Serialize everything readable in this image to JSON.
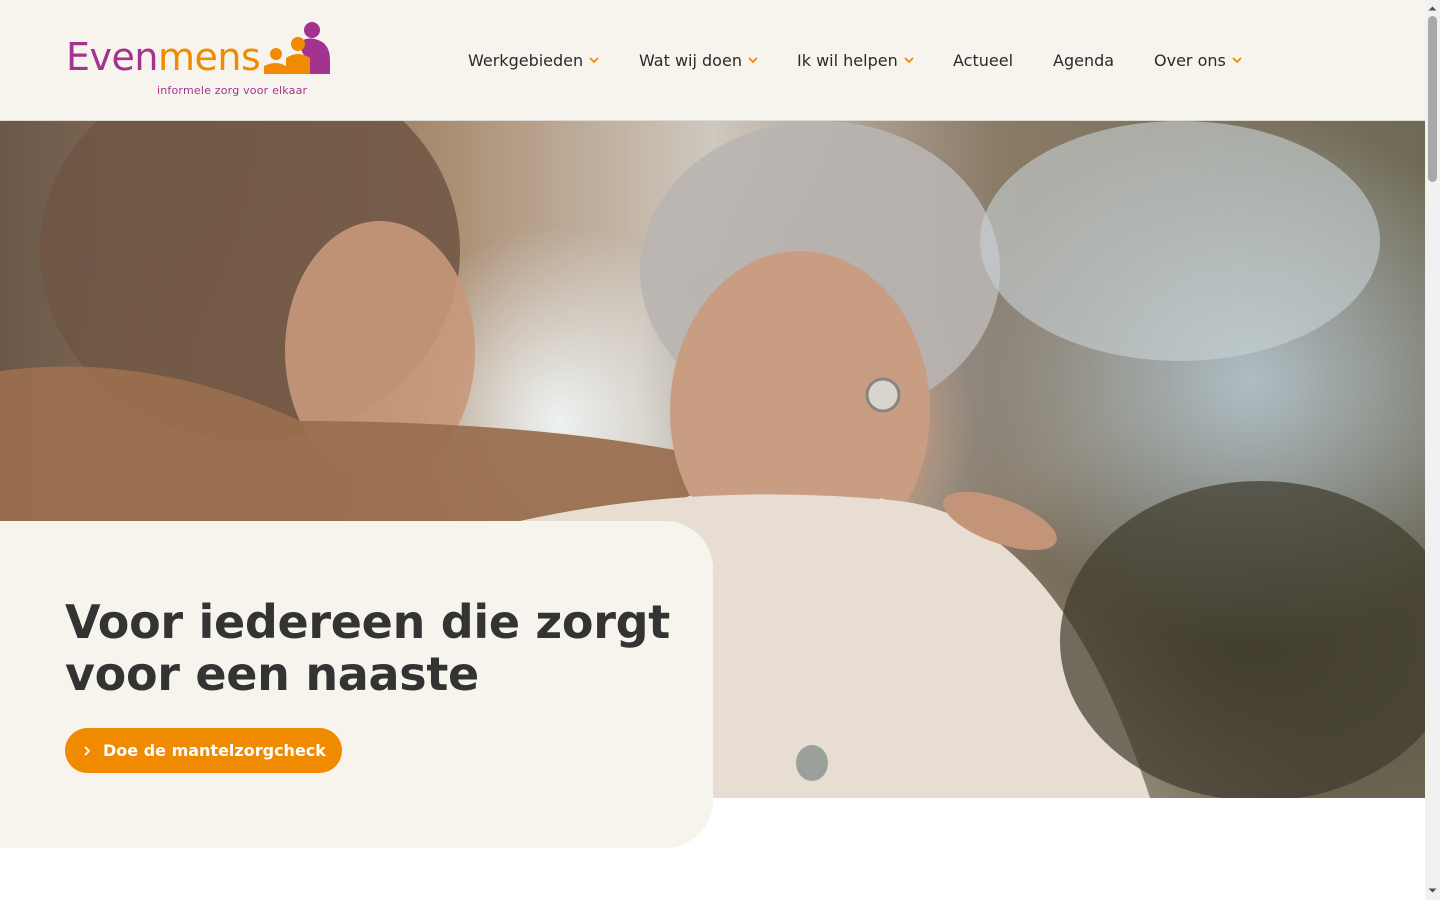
{
  "header": {
    "logo": {
      "word_part1": "Even",
      "word_part2": "mens",
      "tagline": "informele zorg voor elkaar",
      "colors": {
        "purple": "#a4338f",
        "orange": "#f08a00"
      }
    },
    "nav": [
      {
        "label": "Werkgebieden",
        "has_dropdown": true,
        "icon": "chevron-down-icon"
      },
      {
        "label": "Wat wij doen",
        "has_dropdown": true,
        "icon": "chevron-down-icon"
      },
      {
        "label": "Ik wil helpen",
        "has_dropdown": true,
        "icon": "chevron-down-icon"
      },
      {
        "label": "Actueel",
        "has_dropdown": false
      },
      {
        "label": "Agenda",
        "has_dropdown": false
      },
      {
        "label": "Over ons",
        "has_dropdown": true,
        "icon": "chevron-down-icon"
      }
    ]
  },
  "hero": {
    "image_alt": "photo",
    "title": "Voor iedereen die zorgt voor een naaste",
    "cta": {
      "label": "Doe de mantelzorgcheck",
      "icon": "chevron-right-icon"
    }
  },
  "colors": {
    "accent": "#f08a00",
    "brand_purple": "#a4338f",
    "header_bg": "#f7f4ee",
    "card_bg": "#f7f4ee",
    "text": "#333333"
  }
}
